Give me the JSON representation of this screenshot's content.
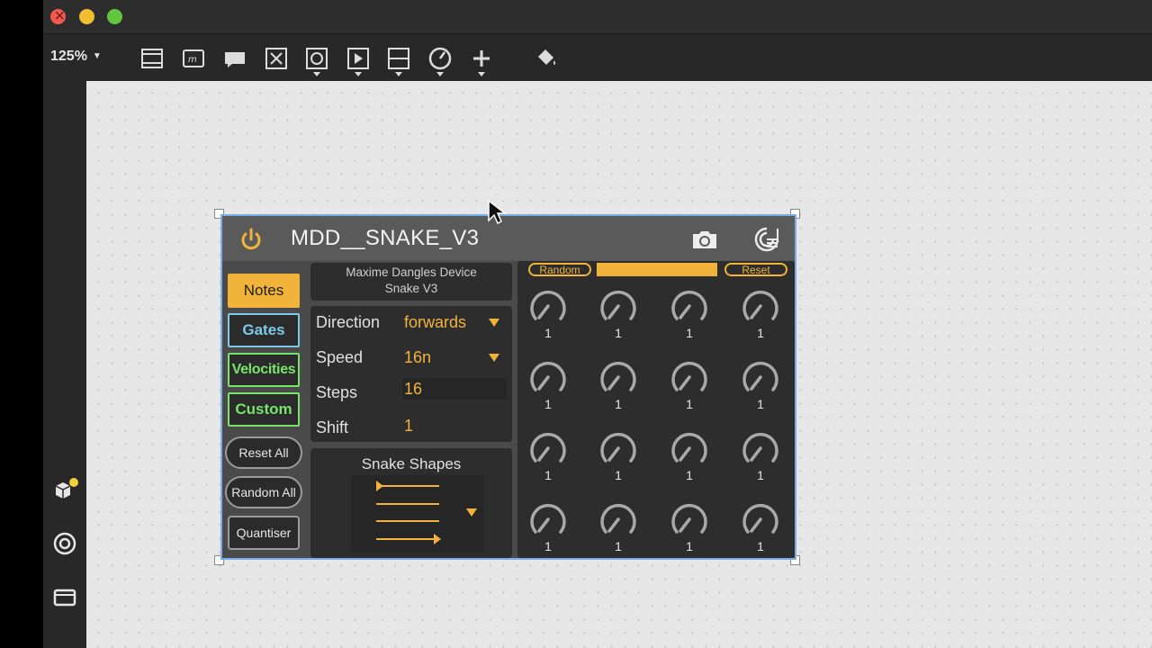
{
  "toolbar": {
    "zoom": "125%"
  },
  "device": {
    "title": "MDD__SNAKE_V3",
    "info_line1": "Maxime Dangles Device",
    "info_line2": "Snake V3",
    "mode_buttons": [
      "Notes",
      "Gates",
      "Velocities",
      "Custom"
    ],
    "action_buttons": [
      "Reset All",
      "Random All",
      "Quantiser"
    ],
    "params": {
      "direction": {
        "label": "Direction",
        "value": "forwards"
      },
      "speed": {
        "label": "Speed",
        "value": "16n"
      },
      "steps": {
        "label": "Steps",
        "value": "16"
      },
      "shift": {
        "label": "Shift",
        "value": "1"
      }
    },
    "shapes_title": "Snake Shapes",
    "random_label": "Random",
    "reset_label": "Reset",
    "knob_values": [
      "1",
      "1",
      "1",
      "1",
      "1",
      "1",
      "1",
      "1",
      "1",
      "1",
      "1",
      "1",
      "1",
      "1",
      "1",
      "1"
    ]
  },
  "colors": {
    "accent": "#f2b33b",
    "gates": "#7ec9e9",
    "velocities": "#78e56a",
    "selection": "#78aee6"
  },
  "icons": {
    "toolbar": [
      "presentation-icon",
      "comment-icon",
      "message-icon",
      "toggle-x-icon",
      "button-icon",
      "play-icon",
      "slider-icon",
      "dial-icon",
      "add-icon",
      "paint-bucket-icon"
    ],
    "sidebar": [
      "objects-icon",
      "target-icon",
      "device-icon"
    ]
  }
}
